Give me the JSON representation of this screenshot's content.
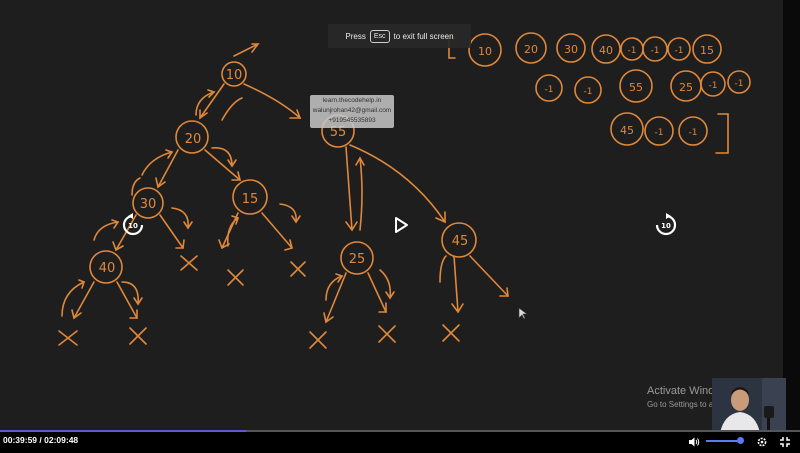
{
  "player": {
    "fullscreen_notice": {
      "before": "Press",
      "key": "Esc",
      "after": "to exit full screen"
    },
    "watermark": [
      "learn.thecodehelp.in",
      "walunjrohan42@gmail.com",
      "+919545535893"
    ],
    "rewind_label": "10",
    "forward_label": "10",
    "current_time": "00:39:59",
    "total_time": "/ 02:09:48",
    "progress_fraction": 0.308,
    "volume_fraction": 0.95,
    "icons": [
      "replay-10-icon",
      "play-icon",
      "forward-10-icon",
      "volume-icon",
      "settings-gear-icon",
      "exit-fullscreen-icon"
    ]
  },
  "os_overlay": {
    "activate_title": "Activate Windows",
    "activate_sub": "Go to Settings to activate Windows."
  },
  "whiteboard": {
    "ink_color": "#e0883a",
    "tree_nodes": [
      "10",
      "20",
      "30",
      "40",
      "15",
      "55",
      "25",
      "45"
    ],
    "level_order_array": [
      "10",
      "20",
      "30",
      "40",
      "-1",
      "-1",
      "-1",
      "15",
      "-1",
      "-1",
      "55",
      "25",
      "-1",
      "-1",
      "45",
      "-1",
      "-1"
    ]
  }
}
